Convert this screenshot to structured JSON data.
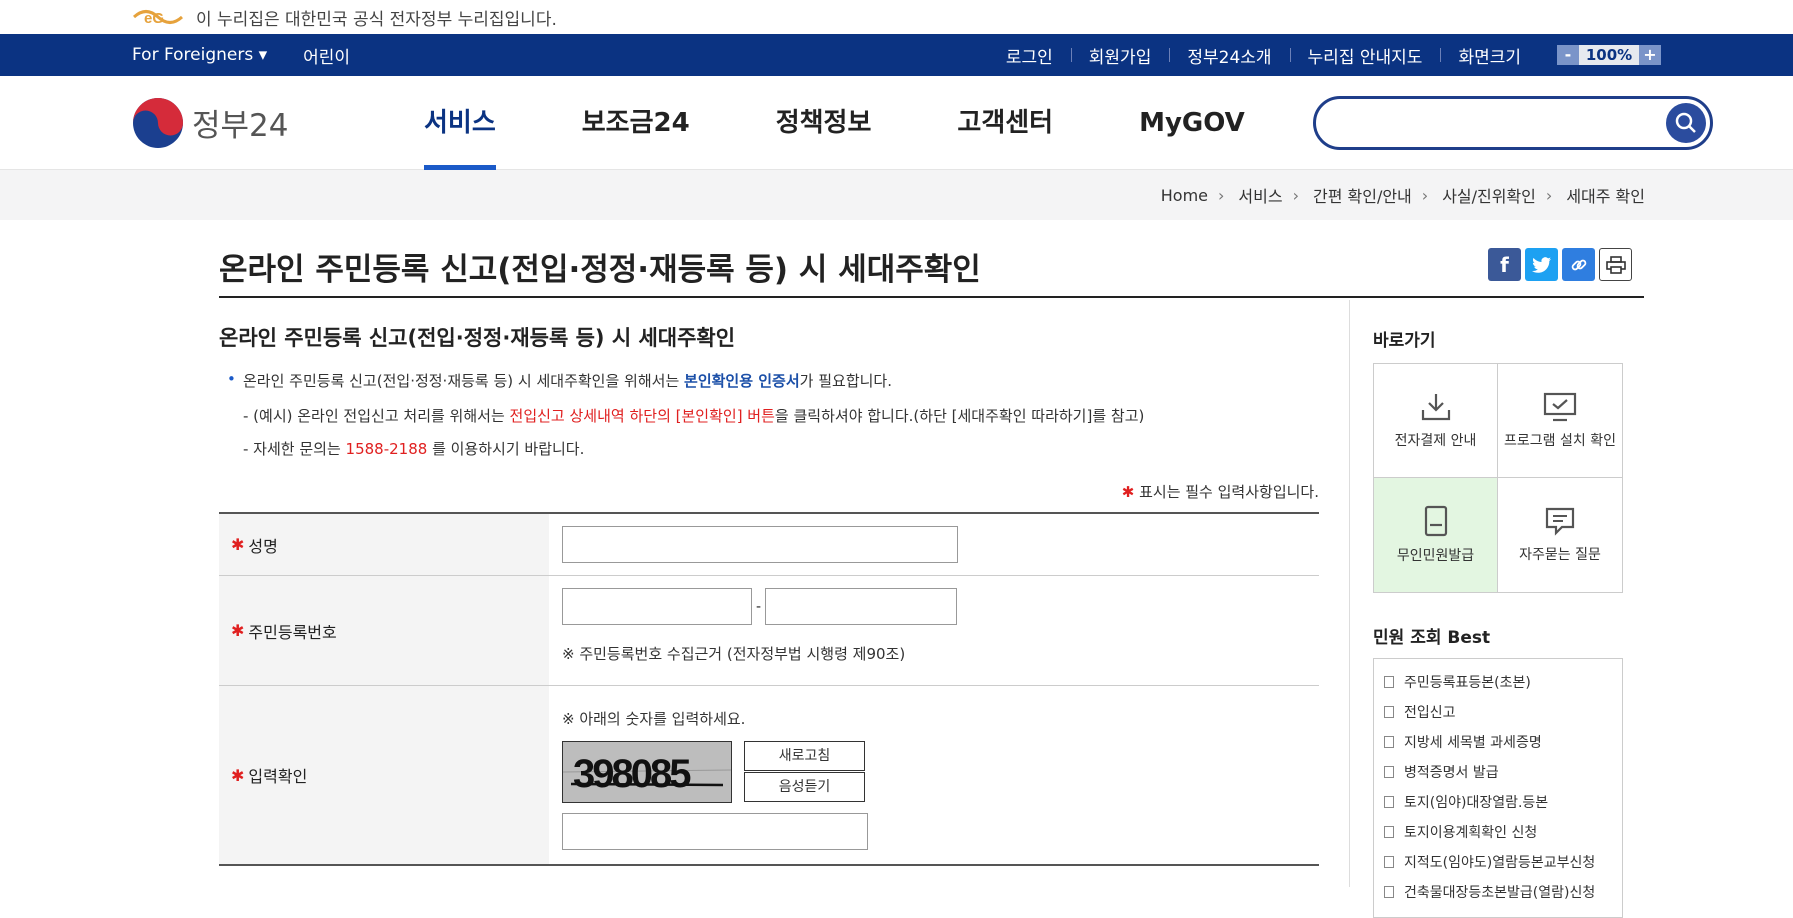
{
  "gov_banner": {
    "text": "이 누리집은 대한민국 공식 전자정부 누리집입니다."
  },
  "topbar": {
    "left": [
      "For Foreigners ▾",
      "어린이"
    ],
    "right": [
      "로그인",
      "회원가입",
      "정부24소개",
      "누리집 안내지도",
      "화면크기"
    ],
    "zoom_minus": "-",
    "zoom_value": "100%",
    "zoom_plus": "+"
  },
  "nav": {
    "brand": "정부24",
    "items": [
      "서비스",
      "보조금24",
      "정책정보",
      "고객센터",
      "MyGOV"
    ],
    "search_placeholder": ""
  },
  "breadcrumb": [
    "Home",
    "서비스",
    "간편 확인/안내",
    "사실/진위확인",
    "세대주 확인"
  ],
  "page": {
    "title": "온라인 주민등록 신고(전입·정정·재등록 등) 시 세대주확인",
    "subtitle": "온라인 주민등록 신고(전입·정정·재등록 등) 시 세대주확인",
    "bullet_pre": "온라인 주민등록 신고(전입·정정·재등록 등) 시 세대주확인을 위해서는 ",
    "bullet_strong": "본인확인용 인증서",
    "bullet_post": "가 필요합니다.",
    "note1_pre": "- (예시) 온라인 전입신고 처리를 위해서는 ",
    "note1_red": "전입신고 상세내역 하단의 [본인확인] 버튼",
    "note1_post": "을 클릭하셔야 합니다.(하단 [세대주확인 따라하기]를 참고)",
    "note2_pre": "- 자세한 문의는 ",
    "note2_red": "1588-2188",
    "note2_post": " 를 이용하시기 바랍니다.",
    "required_note": "표시는 필수 입력사항입니다."
  },
  "form": {
    "name_label": "성명",
    "rrn_label": "주민등록번호",
    "rrn_dash": "-",
    "rrn_hint": "※ 주민등록번호 수집근거 (전자정부법 시행령 제90조)",
    "captcha_label": "입력확인",
    "captcha_hint": "※ 아래의 숫자를 입력하세요.",
    "captcha_text": "398085",
    "refresh_label": "새로고침",
    "audio_label": "음성듣기"
  },
  "sidebar": {
    "quick_title": "바로가기",
    "quick_items": [
      "전자결제 안내",
      "프로그램 설치 확인",
      "무인민원발급",
      "자주묻는 질문"
    ],
    "best_title": "민원 조회 Best",
    "best_items": [
      "주민등록표등본(초본)",
      "전입신고",
      "지방세 세목별 과세증명",
      "병적증명서 발급",
      "토지(임야)대장열람.등본",
      "토지이용계획확인 신청",
      "지적도(임야도)열람등본교부신청",
      "건축물대장등초본발급(열람)신청"
    ]
  },
  "colors": {
    "primary": "#0b3382",
    "accent": "#1b5ac8",
    "required": "#e02020"
  }
}
